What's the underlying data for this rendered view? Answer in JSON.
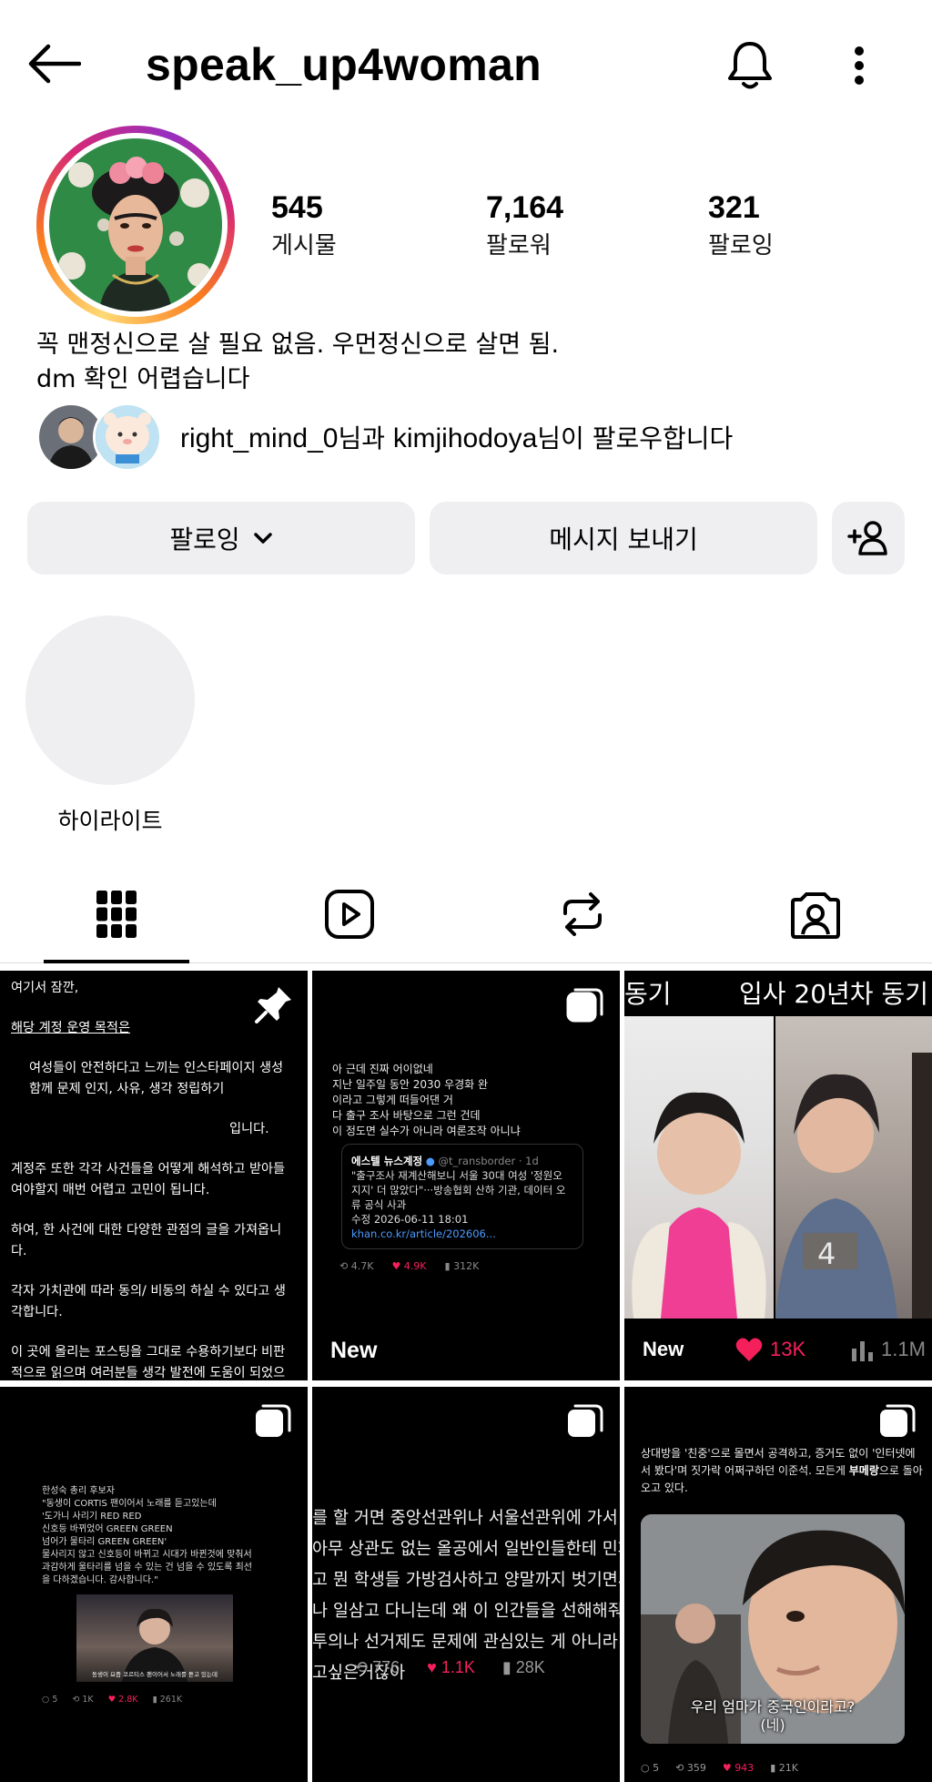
{
  "header": {
    "username": "speak_up4woman"
  },
  "profile": {
    "stats": [
      {
        "value": "545",
        "label": "게시물"
      },
      {
        "value": "7,164",
        "label": "팔로워"
      },
      {
        "value": "321",
        "label": "팔로잉"
      }
    ],
    "bio_line1": "꼭 맨정신으로 살 필요 없음. 우먼정신으로 살면 됨.",
    "bio_line2": "dm 확인 어렵습니다",
    "mutual_user1": "right_mind_0",
    "mutual_mid": "님과 ",
    "mutual_user2": "kimjihodoya",
    "mutual_tail": "님이 팔로우합니다"
  },
  "actions": {
    "following_label": "팔로잉",
    "message_label": "메시지 보내기"
  },
  "highlights": [
    {
      "label": "하이라이트"
    }
  ],
  "posts": {
    "new_label": "New",
    "tile1": {
      "line1": "여기서 잠깐,",
      "line2": "해당 계정 운영 목적은",
      "line3": "여성들이 안전하다고 느끼는 인스타페이지 생성",
      "line4": "함께 문제 인지, 사유, 생각 정립하기",
      "line5": "입니다.",
      "line6": "계정주 또한 각각 사건들을 어떻게 해석하고 받아들여야할지 매번 어렵고 고민이 됩니다.",
      "line7": "하여, 한 사건에 대한 다양한 관점의 글을 가져옵니다.",
      "line8": "각자 가치관에 따라 동의/ 비동의 하실 수 있다고 생각합니다.",
      "line9": "이 곳에 올리는 포스팅을 그대로 수용하기보다 비판적으로 읽으며 여러분들 생각 발전에 도움이 되었으면 합니다."
    },
    "tile2": {
      "l1": "아 근데 진짜 어이없네",
      "l2": "지난 일주일 동안 2030 우경화 완",
      "l3": "이라고 그렇게 떠들어댄 거",
      "l4": "다 출구 조사 바탕으로 그런 건데",
      "l5": "이 정도면 실수가 아니라 여론조작 아니냐",
      "card_source": "에스텔 뉴스계정",
      "card_handle": "@t_ransborder · 1d",
      "card_text": "\"출구조사 재계산해보니 서울 30대 여성 '정원오 지지' 더 많았다\"···방송협회 산하 기관, 데이터 오류 공식 사과",
      "card_date": "수정 2026-06-11 18:01",
      "card_link": "khan.co.kr/article/202606...",
      "s_retweet": "4.7K",
      "s_like": "4.9K",
      "s_views": "312K"
    },
    "tile3": {
      "top_left": "동기",
      "top_right": "입사 20년차 동기",
      "overlay_num": "4",
      "like": "13K",
      "views": "1.1M"
    },
    "tile4": {
      "l1": "한성숙 총리 후보자",
      "l2": "\"동생이 CORTIS 팬이어서 노래를 듣고있는데",
      "l3": "'도가니 사리기 RED RED",
      "l4": "신호등 바뀌었어 GREEN GREEN",
      "l5": "넘어가 물타리 GREEN GREEN'",
      "l6": "물사리지 않고 신호등이 바뀌고 시대가 바뀐것에 맞춰서",
      "l7": "과감하게 울타리를 넘을 수 있는 건 넘을 수 있도록 최선",
      "l8": "을 다하겠습니다. 감사합니다.\"",
      "caption": "동생이 요즘 코르티스 팬이어서 노래를 듣고 있는데",
      "s_reply": "5",
      "s_rt": "1K",
      "s_like": "2.8K",
      "s_views": "261K"
    },
    "tile5": {
      "l1": "를 할 거면 중앙선관위나 서울선관위에 가서 하",
      "l2": "아무 상관도 없는 올공에서 일반인들한테 민페",
      "l3": "고 뭔 학생들 가방검사하고 양말까지 벗기면서",
      "l4": "나 일삼고 다니는데 왜 이 인간들을 선해해줘야",
      "l5": "투의나 선거제도 문제에 관심있는 게 아니라 경",
      "l6": "고싶은거잖아",
      "s_rt": "776",
      "s_like": "1.1K",
      "s_views": "28K"
    },
    "tile6": {
      "text": "상대방을 '친중'으로 몰면서 공격하고, 증거도 없이 '인터넷에서 봤다'며 짓가락 어쩌구하던 이준석. 모든게 ",
      "text_bold": "부메랑",
      "text_tail": "으로 돌아오고 있다.",
      "cap1": "우리 엄마가 중국인이라고?",
      "cap2": "(네)",
      "s_reply": "5",
      "s_rt": "359",
      "s_like": "943",
      "s_views": "21K"
    }
  },
  "colors": {
    "button_bg": "#efeff1",
    "like_pink": "#f5205b",
    "link_blue": "#4c9bff"
  }
}
